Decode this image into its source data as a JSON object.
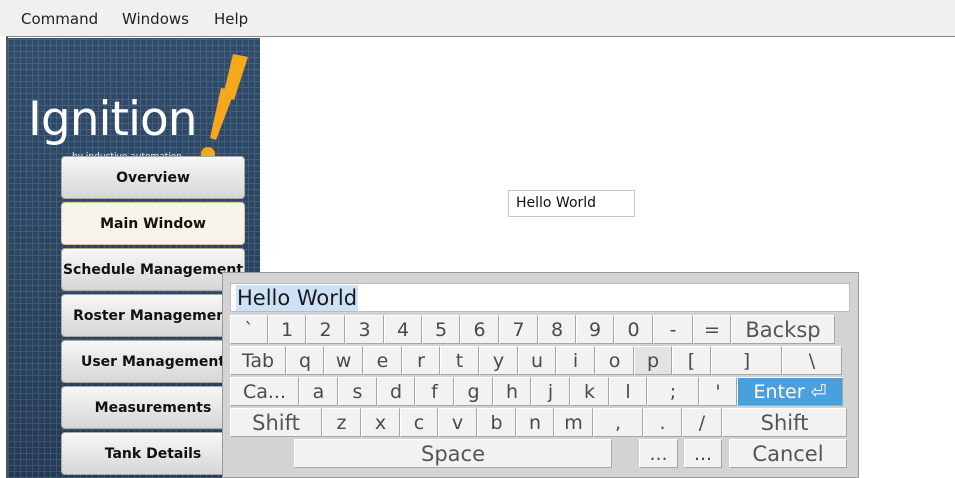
{
  "menubar": {
    "items": [
      "Command",
      "Windows",
      "Help"
    ]
  },
  "logo": {
    "name": "Ignition",
    "tagline": "by inductive automation",
    "tm": "TM"
  },
  "nav": [
    {
      "label": "Overview",
      "active": false
    },
    {
      "label": "Main Window",
      "active": true
    },
    {
      "label": "Schedule Management",
      "active": false
    },
    {
      "label": "Roster Management",
      "active": false
    },
    {
      "label": "User Management",
      "active": false
    },
    {
      "label": "Measurements",
      "active": false
    },
    {
      "label": "Tank Details",
      "active": false
    }
  ],
  "main": {
    "text_field_value": "Hello World"
  },
  "keyboard": {
    "input_value": "Hello World",
    "rows": [
      [
        "`",
        "1",
        "2",
        "3",
        "4",
        "5",
        "6",
        "7",
        "8",
        "9",
        "0",
        "-",
        "=",
        "Backsp"
      ],
      [
        "Tab",
        "q",
        "w",
        "e",
        "r",
        "t",
        "y",
        "u",
        "i",
        "o",
        "p",
        "[",
        "]",
        "\\"
      ],
      [
        "Ca...",
        "a",
        "s",
        "d",
        "f",
        "g",
        "h",
        "j",
        "k",
        "l",
        ";",
        "'",
        "Enter ⏎"
      ],
      [
        "Shift",
        "z",
        "x",
        "c",
        "v",
        "b",
        "n",
        "m",
        ",",
        ".",
        "/",
        "Shift"
      ],
      [
        "Space",
        "...",
        "...",
        "Cancel"
      ]
    ]
  },
  "colors": {
    "sidebar": "#2f4c6b",
    "accent_orange": "#f5a81c",
    "enter_key": "#4aa0dd"
  }
}
